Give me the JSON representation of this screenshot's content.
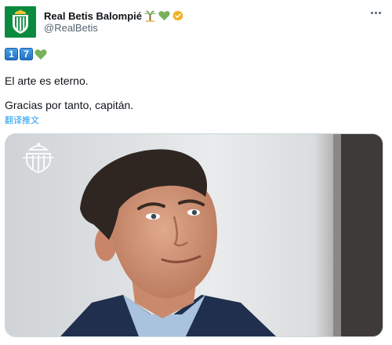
{
  "account": {
    "display_name": "Real Betis Balompié",
    "handle": "@RealBetis",
    "verified_badge_color": "#f2b01e",
    "name_icons": [
      "palm-tree-icon",
      "green-heart-icon",
      "verified-badge-icon"
    ]
  },
  "tweet": {
    "keycaps": [
      "1",
      "7"
    ],
    "heart_color": "#78b159",
    "line1": "El arte es eterno.",
    "line2": "Gracias por tanto, capitán.",
    "translate_label": "翻译推文"
  },
  "colors": {
    "brand_green": "#0a8a3e",
    "link_blue": "#1d9bf0",
    "muted": "#536471"
  }
}
